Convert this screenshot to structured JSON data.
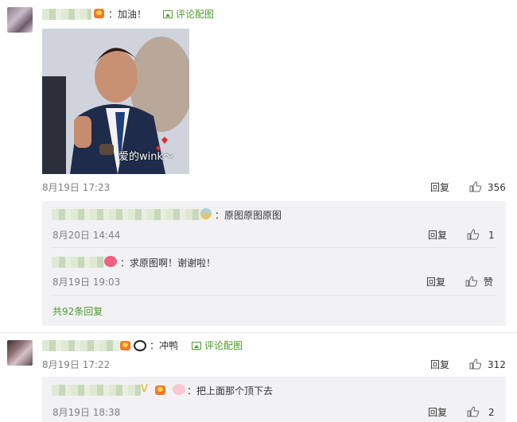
{
  "comments": [
    {
      "text": "：加油！",
      "add_image_label": "评论配图",
      "time": "8月19日 17:23",
      "reply_label": "回复",
      "likes": "356",
      "image_caption": "爱的wink～",
      "replies": [
        {
          "text": "：原图原图原图",
          "time": "8月20日 14:44",
          "reply_label": "回复",
          "likes": "1"
        },
        {
          "text": "：求原图啊！谢谢啦！",
          "time": "8月19日 19:03",
          "reply_label": "回复",
          "likes": "赞"
        }
      ],
      "more_replies": "共92条回复"
    },
    {
      "text": "：冲鸭",
      "add_image_label": "评论配图",
      "time": "8月19日 17:22",
      "reply_label": "回复",
      "likes": "312",
      "replies": [
        {
          "text": "：把上面那个顶下去",
          "time": "8月19日 18:38",
          "reply_label": "回复",
          "likes": "2"
        }
      ]
    }
  ],
  "colors": {
    "accent_green": "#4a9a28",
    "meta_gray": "#808080",
    "panel_bg": "#f2f2f5"
  }
}
